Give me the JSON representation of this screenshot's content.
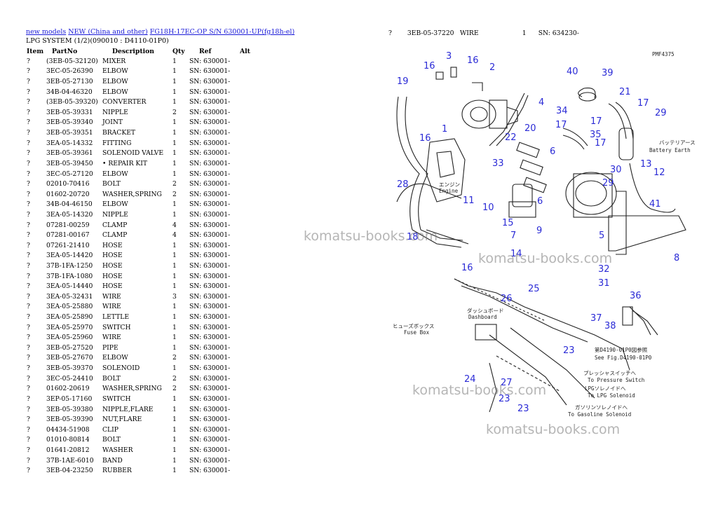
{
  "breadcrumb": {
    "items": [
      "new models",
      "NEW (China and other)",
      "FG18H-17EC-OP S/N 630001-UP(fg18h-el)"
    ]
  },
  "subtitle": "LPG SYSTEM (1/2)(090010 : D4110-01P0)",
  "table": {
    "headers": [
      "Item",
      "PartNo",
      "Description",
      "Qty",
      "Ref",
      "Alt"
    ],
    "rows": [
      [
        "?",
        "(3EB-05-32120)",
        "MIXER",
        "1",
        "SN: 630001-"
      ],
      [
        "?",
        "3EC-05-26390",
        "ELBOW",
        "1",
        "SN: 630001-"
      ],
      [
        "?",
        "3EB-05-27130",
        "ELBOW",
        "1",
        "SN: 630001-"
      ],
      [
        "?",
        "34B-04-46320",
        "ELBOW",
        "1",
        "SN: 630001-"
      ],
      [
        "?",
        "(3EB-05-39320)",
        "CONVERTER",
        "1",
        "SN: 630001-"
      ],
      [
        "?",
        "3EB-05-39331",
        "NIPPLE",
        "2",
        "SN: 630001-"
      ],
      [
        "?",
        "3EB-05-39340",
        "JOINT",
        "1",
        "SN: 630001-"
      ],
      [
        "?",
        "3EB-05-39351",
        "BRACKET",
        "1",
        "SN: 630001-"
      ],
      [
        "?",
        "3EA-05-14332",
        "FITTING",
        "1",
        "SN: 630001-"
      ],
      [
        "?",
        "3EB-05-39361",
        "SOLENOID VALVE",
        "1",
        "SN: 630001-"
      ],
      [
        "?",
        "3EB-05-39450",
        "• REPAIR KIT",
        "1",
        "SN: 630001-"
      ],
      [
        "?",
        "3EC-05-27120",
        "ELBOW",
        "1",
        "SN: 630001-"
      ],
      [
        "?",
        "02010-70416",
        "BOLT",
        "2",
        "SN: 630001-"
      ],
      [
        "?",
        "01602-20720",
        "WASHER,SPRING",
        "2",
        "SN: 630001-"
      ],
      [
        "?",
        "34B-04-46150",
        "ELBOW",
        "1",
        "SN: 630001-"
      ],
      [
        "?",
        "3EA-05-14320",
        "NIPPLE",
        "1",
        "SN: 630001-"
      ],
      [
        "?",
        "07281-00259",
        "CLAMP",
        "4",
        "SN: 630001-"
      ],
      [
        "?",
        "07281-00167",
        "CLAMP",
        "4",
        "SN: 630001-"
      ],
      [
        "?",
        "07261-21410",
        "HOSE",
        "1",
        "SN: 630001-"
      ],
      [
        "?",
        "3EA-05-14420",
        "HOSE",
        "1",
        "SN: 630001-"
      ],
      [
        "?",
        "37B-1FA-1250",
        "HOSE",
        "1",
        "SN: 630001-"
      ],
      [
        "?",
        "37B-1FA-1080",
        "HOSE",
        "1",
        "SN: 630001-"
      ],
      [
        "?",
        "3EA-05-14440",
        "HOSE",
        "1",
        "SN: 630001-"
      ],
      [
        "?",
        "3EA-05-32431",
        "WIRE",
        "3",
        "SN: 630001-"
      ],
      [
        "?",
        "3EA-05-25880",
        "WIRE",
        "1",
        "SN: 630001-"
      ],
      [
        "?",
        "3EA-05-25890",
        "LETTLE",
        "1",
        "SN: 630001-"
      ],
      [
        "?",
        "3EA-05-25970",
        "SWITCH",
        "1",
        "SN: 630001-"
      ],
      [
        "?",
        "3EA-05-25960",
        "WIRE",
        "1",
        "SN: 630001-"
      ],
      [
        "?",
        "3EB-05-27520",
        "PIPE",
        "1",
        "SN: 630001-"
      ],
      [
        "?",
        "3EB-05-27670",
        "ELBOW",
        "2",
        "SN: 630001-"
      ],
      [
        "?",
        "3EB-05-39370",
        "SOLENOID",
        "1",
        "SN: 630001-"
      ],
      [
        "?",
        "3EC-05-24410",
        "BOLT",
        "2",
        "SN: 630001-"
      ],
      [
        "?",
        "01602-20619",
        "WASHER,SPRING",
        "2",
        "SN: 630001-"
      ],
      [
        "?",
        "3EP-05-17160",
        "SWITCH",
        "1",
        "SN: 630001-"
      ],
      [
        "?",
        "3EB-05-39380",
        "NIPPLE,FLARE",
        "1",
        "SN: 630001-"
      ],
      [
        "?",
        "3EB-05-39390",
        "NUT,FLARE",
        "1",
        "SN: 630001-"
      ],
      [
        "?",
        "04434-51908",
        "CLIP",
        "1",
        "SN: 630001-"
      ],
      [
        "?",
        "01010-80814",
        "BOLT",
        "1",
        "SN: 630001-"
      ],
      [
        "?",
        "01641-20812",
        "WASHER",
        "1",
        "SN: 630001-"
      ],
      [
        "?",
        "37B-1AE-6010",
        "BAND",
        "1",
        "SN: 630001-"
      ],
      [
        "?",
        "3EB-04-23250",
        "RUBBER",
        "1",
        "SN: 630001-"
      ]
    ]
  },
  "extra_row": [
    "?",
    "3EB-05-37220",
    "WIRE",
    "1",
    "SN: 634230-"
  ],
  "diagram": {
    "code": "PMF4375",
    "callouts": [
      "1",
      "2",
      "3",
      "4",
      "5",
      "6",
      "6",
      "7",
      "8",
      "9",
      "10",
      "11",
      "12",
      "13",
      "14",
      "15",
      "16",
      "16",
      "16",
      "16",
      "17",
      "17",
      "17",
      "17",
      "18",
      "19",
      "20",
      "21",
      "22",
      "23",
      "23",
      "23",
      "24",
      "25",
      "26",
      "27",
      "28",
      "29",
      "29",
      "30",
      "31",
      "32",
      "33",
      "34",
      "35",
      "36",
      "37",
      "38",
      "39",
      "40",
      "41"
    ],
    "notes": {
      "engine_jp": "エンジン",
      "engine": "Engine",
      "battery_jp": "バッテリアース",
      "battery": "Battery Earth",
      "dashboard_jp": "ダッシュボード",
      "dashboard": "Dashboard",
      "fusebox_jp": "ヒューズボックス",
      "fusebox": "Fuse Box",
      "see_jp": "第D4190-01P0図参照",
      "see": "See Fig.D4190-01P0",
      "pressure_jp": "プレッシャスイッチへ",
      "pressure": "To Pressure Switch",
      "lpg_jp": "LPGソレノイドへ",
      "lpg": "To LPG Solenoid",
      "gas_jp": "ガソリンソレノイドへ",
      "gas": "To Gasoline Solenoid"
    }
  },
  "watermark": "komatsu-books.com",
  "colors": {
    "link": "#1a1ad8",
    "callout": "#2b2bd6",
    "watermark": "#808080"
  }
}
